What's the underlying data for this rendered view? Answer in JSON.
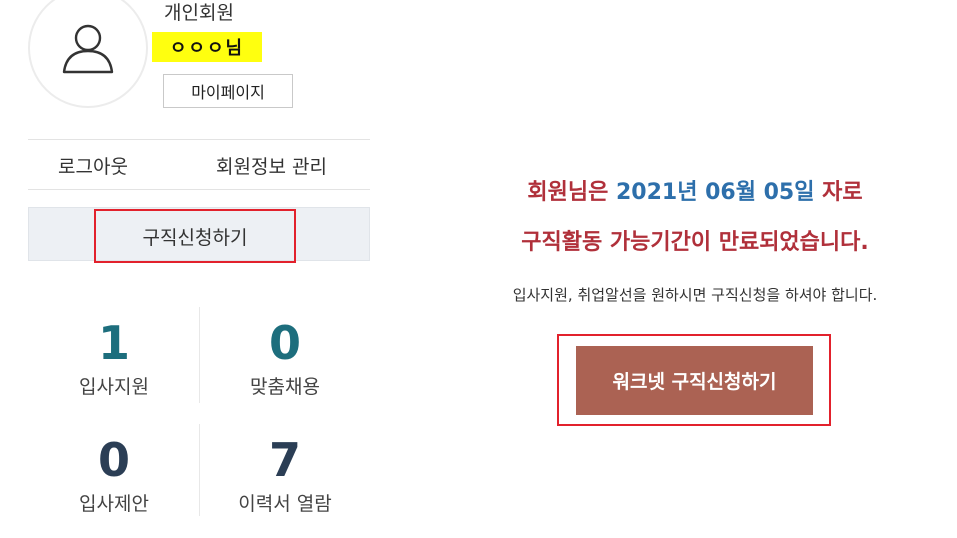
{
  "profile": {
    "member_type": "개인회원",
    "name": "ㅇㅇㅇ님",
    "mypage_label": "마이페이지"
  },
  "links": {
    "logout": "로그아웃",
    "manage_info": "회원정보 관리"
  },
  "apply_job_label": "구직신청하기",
  "stats": [
    {
      "value": "1",
      "label": "입사지원",
      "color": "#1d6e7d"
    },
    {
      "value": "0",
      "label": "맞춤채용",
      "color": "#1d6e7d"
    },
    {
      "value": "0",
      "label": "입사제안",
      "color": "#2b3e55"
    },
    {
      "value": "7",
      "label": "이력서 열람",
      "color": "#2b3e55"
    }
  ],
  "notice": {
    "line1_prefix": "회원님은 ",
    "line1_date": "2021년 06월 05일",
    "line1_suffix": " 자로",
    "line2": "구직활동 가능기간이 만료되었습니다.",
    "sub": "입사지원, 취업알선을 원하시면 구직신청을 하셔야 합니다.",
    "button_label": "워크넷 구직신청하기"
  },
  "colors": {
    "highlight": "#ffff0f",
    "accent_red": "#b0303a",
    "date_blue": "#2d6fab",
    "button_brown": "#ab6253",
    "outline_red": "#e2212c"
  }
}
